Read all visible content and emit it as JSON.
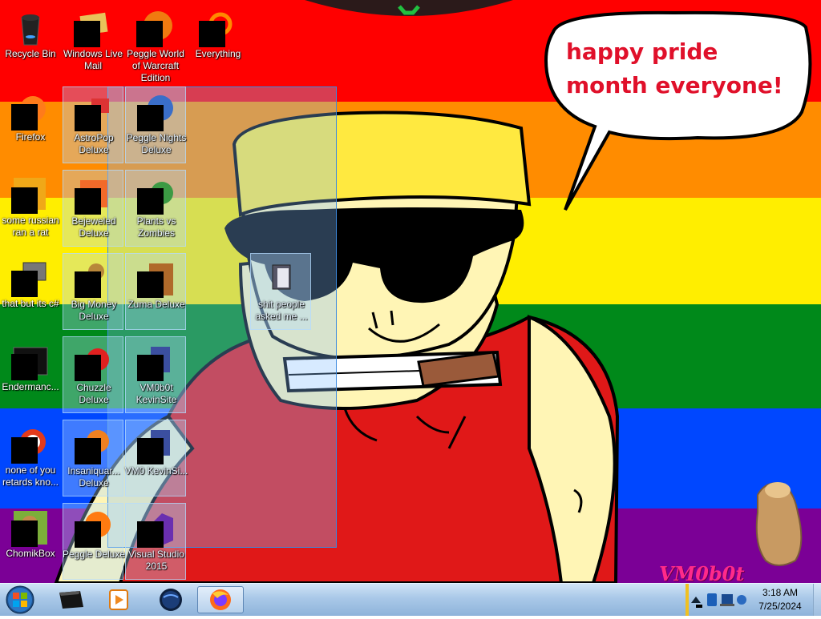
{
  "wallpaper": {
    "speech_bubble_text": "happy pride month everyone!",
    "watermark": "VM0b0t",
    "stripe_colors": [
      "#ff0000",
      "#ff8c00",
      "#ffee00",
      "#00891a",
      "#0047ff",
      "#7b0096"
    ]
  },
  "desktop": {
    "icons": [
      {
        "label": "Recycle Bin",
        "icon": "recycle-bin-icon",
        "selected": false
      },
      {
        "label": "Windows Live Mail",
        "icon": "mail-icon",
        "selected": false
      },
      {
        "label": "Peggle World of Warcraft Edition",
        "icon": "peggle-icon",
        "selected": false
      },
      {
        "label": "Everything",
        "icon": "search-magnifier-icon",
        "selected": false
      },
      {
        "label": "Firefox",
        "icon": "firefox-icon",
        "selected": false
      },
      {
        "label": "AstroPop Deluxe",
        "icon": "astropop-icon",
        "selected": true
      },
      {
        "label": "Peggle Nights Deluxe",
        "icon": "peggle-nights-icon",
        "selected": true
      },
      {
        "label": "some russian ran a rat",
        "icon": "app-icon",
        "selected": false
      },
      {
        "label": "Bejeweled Deluxe",
        "icon": "bejeweled-icon",
        "selected": true
      },
      {
        "label": "Plants vs Zombies",
        "icon": "plants-vs-zombies-icon",
        "selected": true
      },
      {
        "label": "that but its c#",
        "icon": "folder-stack-icon",
        "selected": false
      },
      {
        "label": "Big Money Deluxe",
        "icon": "money-bag-icon",
        "selected": true
      },
      {
        "label": "Zuma Deluxe",
        "icon": "zuma-icon",
        "selected": true
      },
      {
        "label": "shit people asked me ...",
        "icon": "folder-icon",
        "selected": true
      },
      {
        "label": "Endermanc...",
        "icon": "terminal-icon",
        "selected": false
      },
      {
        "label": "Chuzzle Deluxe",
        "icon": "chuzzle-icon",
        "selected": true
      },
      {
        "label": "VM0b0t KevinSite",
        "icon": "document-icon",
        "selected": true
      },
      {
        "label": "none of you retards kno...",
        "icon": "browser-icon",
        "selected": false
      },
      {
        "label": "Insaniquar... Deluxe",
        "icon": "insaniquarium-icon",
        "selected": true
      },
      {
        "label": "VM0 KevinSi...",
        "icon": "document-icon",
        "selected": true
      },
      {
        "label": "ChomikBox",
        "icon": "chomikbox-icon",
        "selected": false
      },
      {
        "label": "Peggle Deluxe",
        "icon": "peggle-icon",
        "selected": true
      },
      {
        "label": "Visual Studio 2015",
        "icon": "visual-studio-icon",
        "selected": true
      }
    ]
  },
  "taskbar": {
    "start_icon": "windows-start-orb-icon",
    "pinned": [
      {
        "name": "taskbar-command-prompt",
        "icon": "command-prompt-icon",
        "active": false
      },
      {
        "name": "taskbar-media-player",
        "icon": "media-player-icon",
        "active": false
      },
      {
        "name": "taskbar-globe",
        "icon": "globe-icon",
        "active": false
      },
      {
        "name": "taskbar-firefox",
        "icon": "firefox-icon",
        "active": true
      }
    ],
    "tray_icons": [
      "tray-overflow-icon",
      "bluetooth-icon",
      "network-icon",
      "volume-icon"
    ],
    "clock": {
      "time": "3:18 AM",
      "date": "7/25/2024"
    }
  }
}
